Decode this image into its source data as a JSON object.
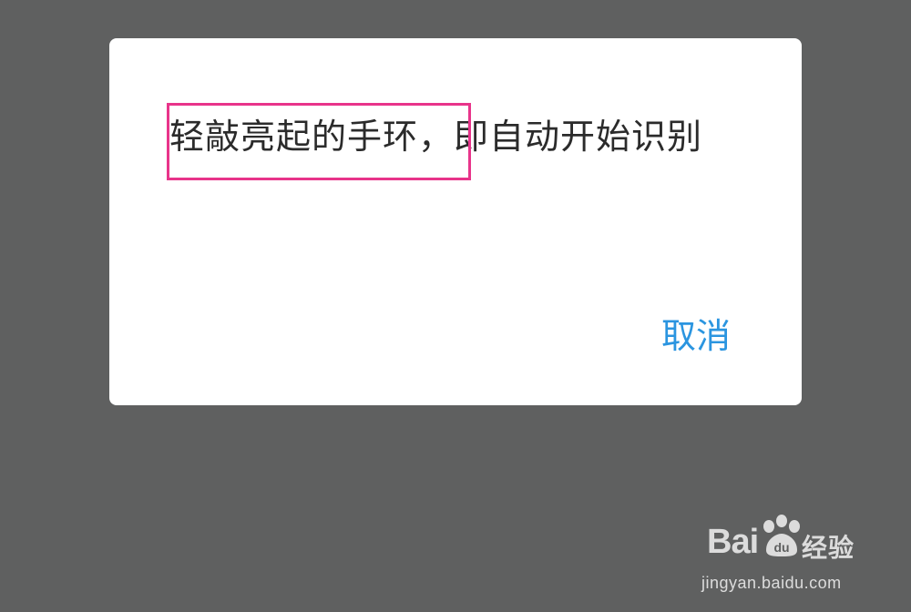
{
  "dialog": {
    "message": "轻敲亮起的手环，即自动开始识别",
    "cancel_label": "取消"
  },
  "watermark": {
    "logo_text": "Bai",
    "logo_du": "du",
    "cn_text": "经验",
    "url": "jingyan.baidu.com"
  },
  "colors": {
    "backdrop": "#5f6060",
    "dialog_bg": "#ffffff",
    "message_text": "#2b2b2b",
    "accent": "#2b95e0",
    "highlight": "#e8348a"
  }
}
